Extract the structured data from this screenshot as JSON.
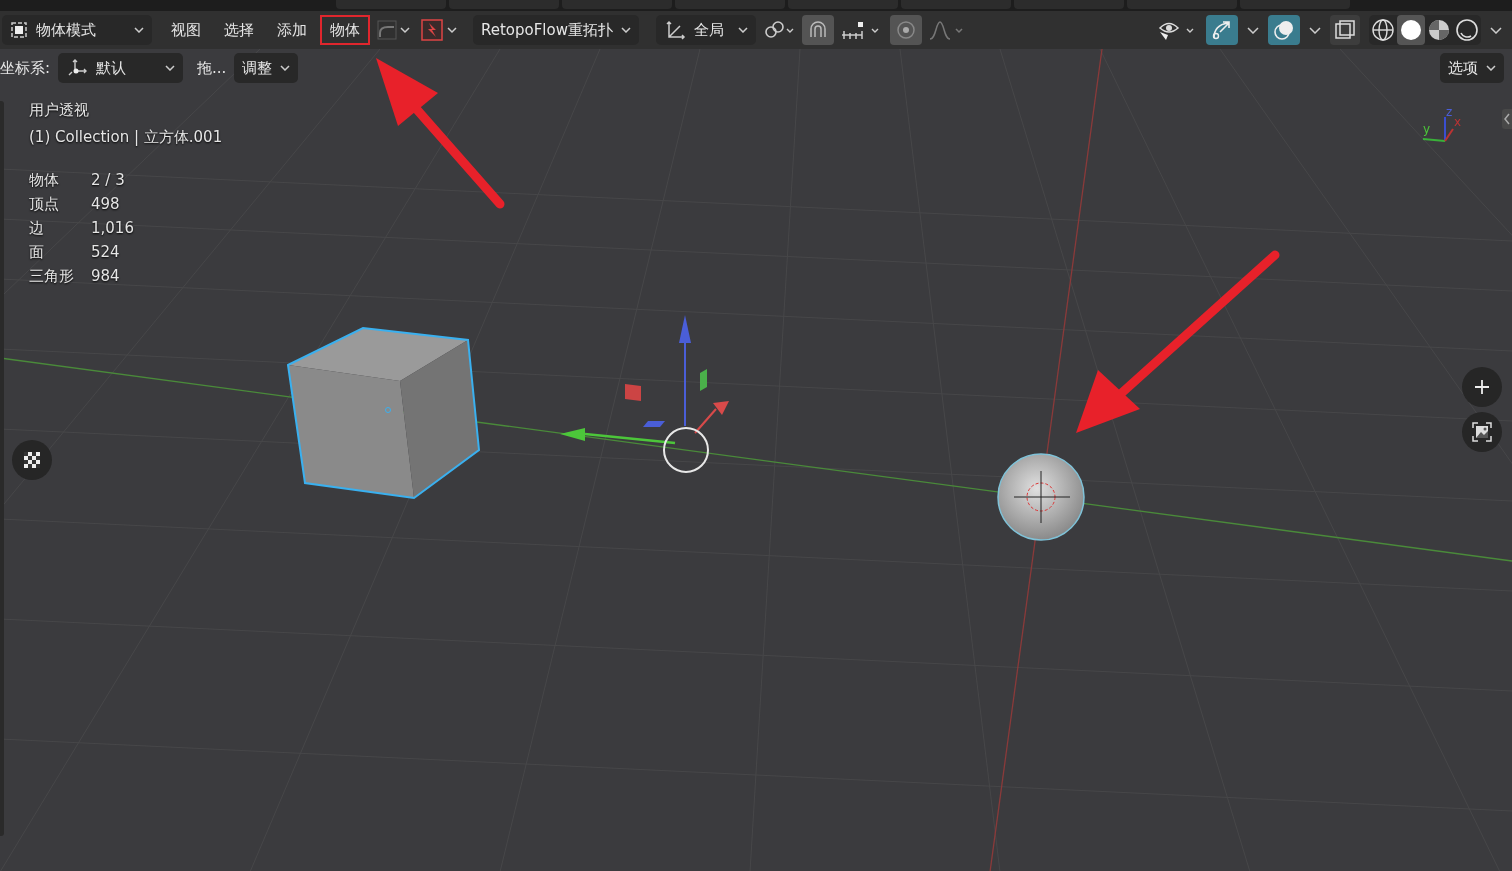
{
  "header": {
    "mode_menu": {
      "label": "物体模式"
    },
    "menus": [
      {
        "label": "视图",
        "highlighted": false
      },
      {
        "label": "选择",
        "highlighted": false
      },
      {
        "label": "添加",
        "highlighted": false
      },
      {
        "label": "物体",
        "highlighted": true
      }
    ],
    "retopo_menu": {
      "label": "RetopoFlow重拓扑"
    },
    "orientation_menu": {
      "label": "全局"
    },
    "snap_on": true,
    "proportional_on": true,
    "show_gizmo": true,
    "show_overlays": true,
    "shading": [
      {
        "kind": "wireframe",
        "selected": false
      },
      {
        "kind": "solid",
        "selected": true
      },
      {
        "kind": "material",
        "selected": false
      },
      {
        "kind": "rendered",
        "selected": false
      }
    ]
  },
  "tool_settings": {
    "coordinate_label": "坐标系:",
    "pivot_menu": {
      "label": "默认"
    },
    "drag_label": "拖...",
    "adjust_menu": {
      "label": "调整"
    },
    "options_menu": {
      "label": "选项"
    }
  },
  "viewport": {
    "view_name": "用户透视",
    "collection_info": "(1) Collection | 立方体.001",
    "stats": [
      {
        "label": "物体",
        "value": "2 / 3"
      },
      {
        "label": "顶点",
        "value": "498"
      },
      {
        "label": "边",
        "value": "1,016"
      },
      {
        "label": "面",
        "value": "524"
      },
      {
        "label": "三角形",
        "value": "984"
      }
    ],
    "gizmo": {
      "x_label": "x",
      "y_label": "y",
      "z_label": "z"
    }
  }
}
